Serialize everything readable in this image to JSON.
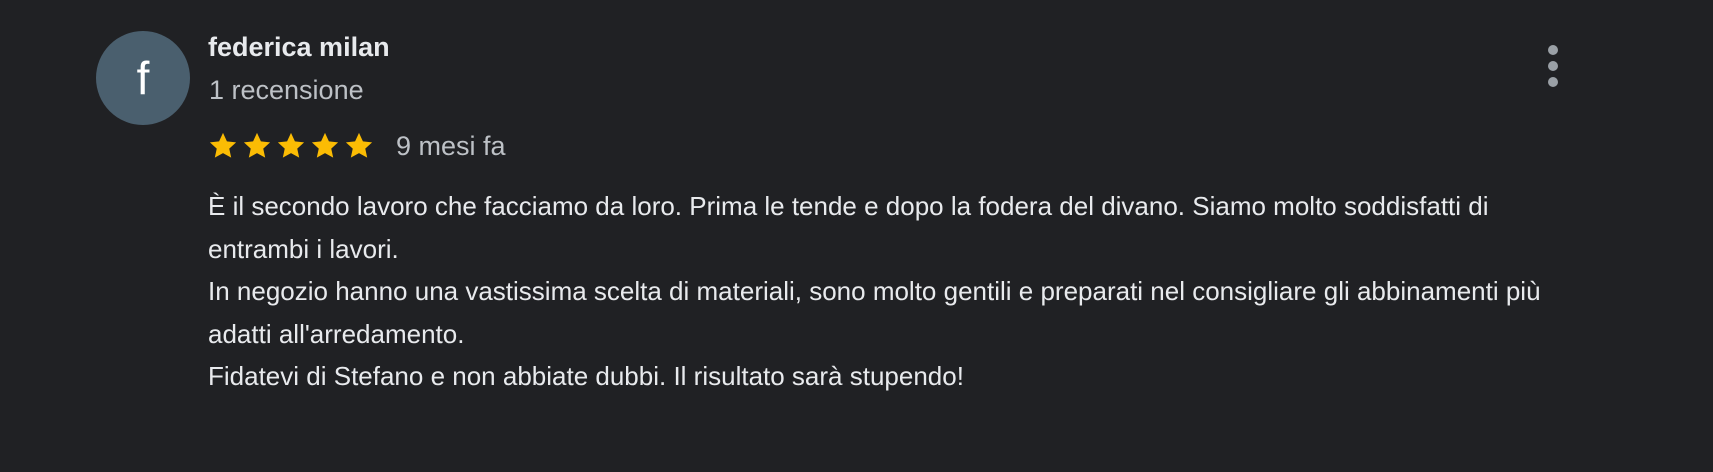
{
  "review": {
    "avatar_letter": "f",
    "avatar_color": "#4a5f6e",
    "author_name": "federica milan",
    "review_count": "1 recensione",
    "rating": 5,
    "rating_max": 5,
    "star_color": "#fbbc04",
    "date": "9 mesi fa",
    "menu_icon": "more-vert-icon",
    "text_paragraphs": [
      "È il secondo lavoro che facciamo da loro. Prima le tende e dopo la fodera del divano. Siamo molto soddisfatti di entrambi i lavori.",
      "In negozio hanno una vastissima scelta di materiali, sono molto gentili e preparati nel consigliare gli abbinamenti più adatti all'arredamento.",
      "Fidatevi di Stefano e non abbiate dubbi. Il risultato sarà stupendo!"
    ]
  }
}
